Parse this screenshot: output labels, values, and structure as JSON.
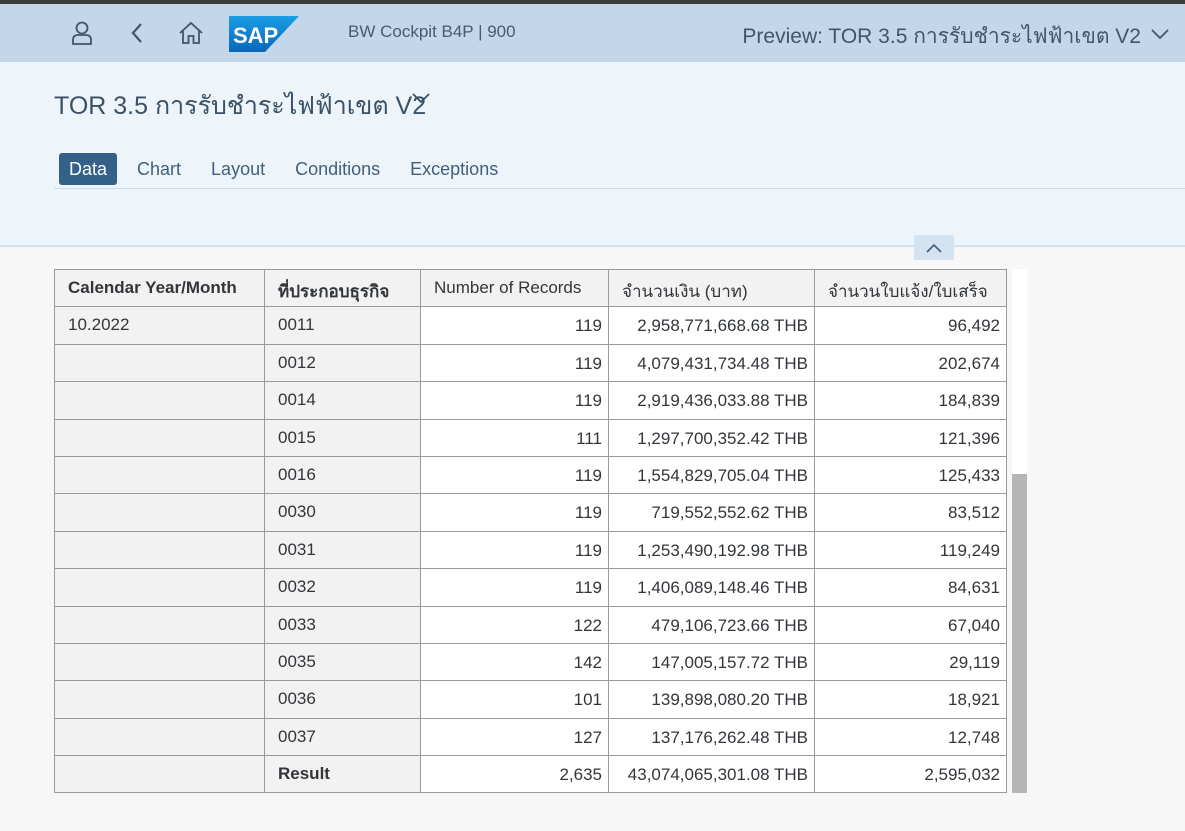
{
  "shell": {
    "user_icon": "user-icon",
    "back_icon": "back-arrow-icon",
    "home_icon": "home-icon",
    "logo_text": "SAP",
    "system_title": "BW Cockpit B4P | 900",
    "preview_title": "Preview: TOR 3.5 การรับชำระไฟฟ้าเขต V2"
  },
  "page": {
    "title": "TOR 3.5 การรับชำระไฟฟ้าเขต V2"
  },
  "tabs": [
    {
      "label": "Data",
      "active": true
    },
    {
      "label": "Chart",
      "active": false
    },
    {
      "label": "Layout",
      "active": false
    },
    {
      "label": "Conditions",
      "active": false
    },
    {
      "label": "Exceptions",
      "active": false
    }
  ],
  "table": {
    "headers": [
      "Calendar Year/Month",
      "ที่ประกอบธุรกิจ",
      "Number of Records",
      "จำนวนเงิน (บาท)",
      "จำนวนใบแจ้ง/ใบเสร็จ"
    ],
    "rows": [
      [
        "10.2022",
        "0011",
        "119",
        "2,958,771,668.68 THB",
        "96,492"
      ],
      [
        "",
        "0012",
        "119",
        "4,079,431,734.48 THB",
        "202,674"
      ],
      [
        "",
        "0014",
        "119",
        "2,919,436,033.88 THB",
        "184,839"
      ],
      [
        "",
        "0015",
        "111",
        "1,297,700,352.42 THB",
        "121,396"
      ],
      [
        "",
        "0016",
        "119",
        "1,554,829,705.04 THB",
        "125,433"
      ],
      [
        "",
        "0030",
        "119",
        "719,552,552.62 THB",
        "83,512"
      ],
      [
        "",
        "0031",
        "119",
        "1,253,490,192.98 THB",
        "119,249"
      ],
      [
        "",
        "0032",
        "119",
        "1,406,089,148.46 THB",
        "84,631"
      ],
      [
        "",
        "0033",
        "122",
        "479,106,723.66 THB",
        "67,040"
      ],
      [
        "",
        "0035",
        "142",
        "147,005,157.72 THB",
        "29,119"
      ],
      [
        "",
        "0036",
        "101",
        "139,898,080.20 THB",
        "18,921"
      ],
      [
        "",
        "0037",
        "127",
        "137,176,262.48 THB",
        "12,748"
      ],
      [
        "",
        "Result",
        "2,635",
        "43,074,065,301.08 THB",
        "2,595,032"
      ]
    ]
  }
}
